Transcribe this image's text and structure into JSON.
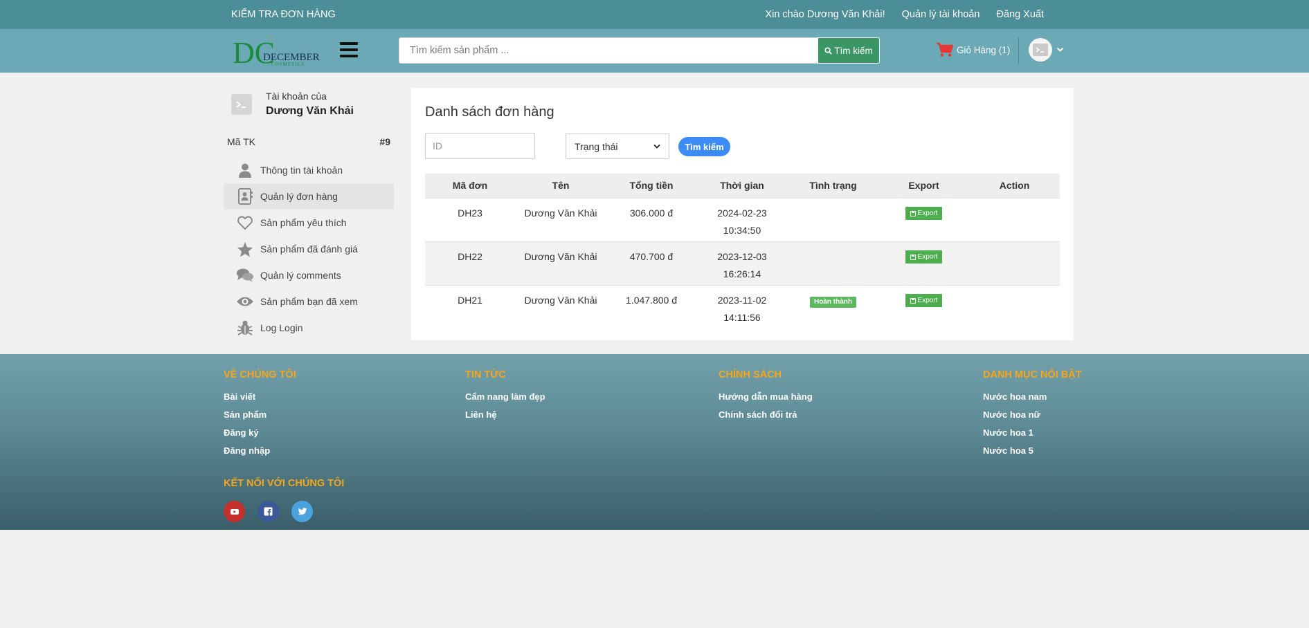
{
  "topbar": {
    "check_order": "KIỂM TRA ĐƠN HÀNG",
    "greeting": "Xin chào Dương Văn Khải!",
    "account_mgmt": "Quản lý tài khoản",
    "logout": "Đăng Xuất"
  },
  "header": {
    "logo_letters": "DC",
    "logo_line1": "DECEMBER",
    "logo_line2": "COSMETICS",
    "search_placeholder": "Tìm kiếm sản phẩm ...",
    "search_button": "Tìm kiếm",
    "cart_label": "Giỏ Hàng (1)"
  },
  "sidebar": {
    "account_of": "Tài khoản của",
    "account_name": "Dương Văn Khải",
    "id_label": "Mã TK",
    "id_value": "#9",
    "items": [
      {
        "label": "Thông tin tài khoản",
        "icon": "user-icon"
      },
      {
        "label": "Quản lý đơn hàng",
        "icon": "contact-book-icon"
      },
      {
        "label": "Sản phẩm yêu thích",
        "icon": "heart-icon"
      },
      {
        "label": "Sản phẩm đã đánh giá",
        "icon": "star-icon"
      },
      {
        "label": "Quản lý comments",
        "icon": "comments-icon"
      },
      {
        "label": "Sản phẩm bạn đã xem",
        "icon": "eye-icon"
      },
      {
        "label": "Log Login",
        "icon": "bug-icon"
      }
    ]
  },
  "main": {
    "title": "Danh sách đơn hàng",
    "id_placeholder": "ID",
    "status_select": "Trạng thái",
    "filter_button": "Tìm kiếm",
    "columns": [
      "Mã đơn",
      "Tên",
      "Tổng tiền",
      "Thời gian",
      "Tình trạng",
      "Export",
      "Action"
    ],
    "export_label": "Export",
    "rows": [
      {
        "id": "DH23",
        "name": "Dương Văn Khải",
        "total": "306.000 đ",
        "date": "2024-02-23",
        "time": "10:34:50",
        "status": ""
      },
      {
        "id": "DH22",
        "name": "Dương Văn Khải",
        "total": "470.700 đ",
        "date": "2023-12-03",
        "time": "16:26:14",
        "status": "Tiếp nhận"
      },
      {
        "id": "DH21",
        "name": "Dương Văn Khải",
        "total": "1.047.800 đ",
        "date": "2023-11-02",
        "time": "14:11:56",
        "status": "Hoàn thành"
      }
    ]
  },
  "footer": {
    "about": {
      "title": "VỀ CHÚNG TÔI",
      "links": [
        "Bài viết",
        "Sản phẩm",
        "Đăng ký",
        "Đăng nhập"
      ]
    },
    "news": {
      "title": "TIN TỨC",
      "links": [
        "Cẩm nang làm đẹp",
        "Liên hệ"
      ]
    },
    "policy": {
      "title": "CHÍNH SÁCH",
      "links": [
        "Hướng dẫn mua hàng",
        "Chính sách đổi trả"
      ]
    },
    "featured": {
      "title": "DANH MỤC NỔI BẬT",
      "links": [
        "Nước hoa nam",
        "Nước hoa nữ",
        "Nước hoa 1",
        "Nước hoa 5"
      ]
    },
    "connect_title": "KẾT NỐI VỚI CHÚNG TÔI",
    "social": [
      "youtube-icon",
      "facebook-icon",
      "twitter-icon"
    ]
  },
  "colors": {
    "topbar": "#4b8e97",
    "header": "#6ba9b7",
    "search_button": "#3a9664",
    "filter_button": "#3d8cf5",
    "export_button": "#4cae4c",
    "footer_heading": "#f6a61b",
    "youtube": "#c4302b",
    "facebook": "#3b5998",
    "twitter": "#4aa3df"
  }
}
